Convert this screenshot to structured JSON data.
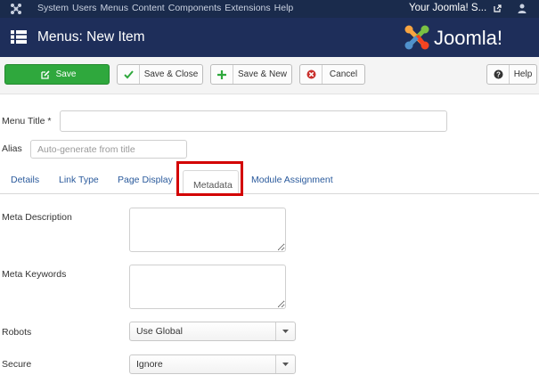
{
  "topbar": {
    "menu": [
      "System",
      "Users",
      "Menus",
      "Content",
      "Components",
      "Extensions",
      "Help"
    ],
    "site_name": "Your Joomla! S..."
  },
  "header": {
    "title": "Menus: New Item",
    "logo_text": "Joomla!"
  },
  "toolbar": {
    "save": "Save",
    "save_close": "Save & Close",
    "save_new": "Save & New",
    "cancel": "Cancel",
    "help": "Help"
  },
  "form": {
    "menu_title_label": "Menu Title *",
    "menu_title_value": "",
    "alias_label": "Alias",
    "alias_placeholder": "Auto-generate from title"
  },
  "tabs": [
    "Details",
    "Link Type",
    "Page Display",
    "Metadata",
    "Module Assignment"
  ],
  "active_tab": "Metadata",
  "metadata": {
    "meta_description_label": "Meta Description",
    "meta_keywords_label": "Meta Keywords",
    "robots_label": "Robots",
    "robots_value": "Use Global",
    "secure_label": "Secure",
    "secure_value": "Ignore"
  },
  "colors": {
    "topbar": "#1a2b4c",
    "header": "#1e2e5a",
    "save_green": "#2fa83d",
    "highlight_red": "#d30000",
    "link_blue": "#2a5a9c"
  }
}
